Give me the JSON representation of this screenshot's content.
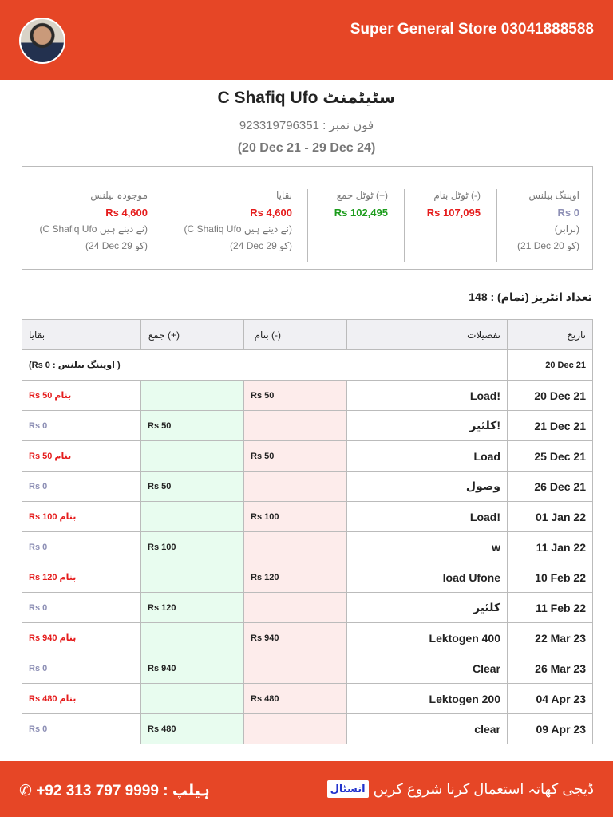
{
  "header": {
    "store": "Super General Store 03041888588"
  },
  "statement": {
    "title": "C Shafiq Ufo سٹیٹمنٹ",
    "phone": "فون نمبر : 923319796351",
    "range": "(20 Dec 21 - 29 Dec 24)"
  },
  "summary": {
    "opening": {
      "label": "اوپننگ بیلنس",
      "value": "Rs 0",
      "note": "(برابر)",
      "date": "(21 Dec کو 20)"
    },
    "banam": {
      "label": "ٹوٹل بنام (-)",
      "value": "Rs 107,095"
    },
    "jama": {
      "label": "ٹوٹل جمع (+)",
      "value": "Rs 102,495"
    },
    "baqaya": {
      "label": "بقایا",
      "value": "Rs 4,600",
      "note": "(C Shafiq Ufo نے دینے ہیں)",
      "date": "(24 Dec کو 29)"
    },
    "current": {
      "label": "موجودہ بیلنس",
      "value": "Rs 4,600",
      "note": "(C Shafiq Ufo نے دینے ہیں)",
      "date": "(24 Dec کو 29)"
    }
  },
  "entries_count": "تعداد انٹریز (تمام) : 148",
  "table": {
    "headers": {
      "date": "تاریخ",
      "details": "تفصیلات",
      "banam": "بنام (-)",
      "jama": "جمع (+)",
      "baqaya": "بقایا"
    },
    "opening_row": {
      "date": "20 Dec 21",
      "text": "(Rs 0 : اوپننگ بیلنس )"
    },
    "rows": [
      {
        "date": "20 Dec 21",
        "details": "Load!",
        "banam": "Rs 50",
        "jama": "",
        "baqaya": "Rs 50 بنام"
      },
      {
        "date": "21 Dec 21",
        "details": "کلئیر!",
        "banam": "",
        "jama": "Rs 50",
        "baqaya": "Rs 0"
      },
      {
        "date": "25 Dec 21",
        "details": "Load",
        "banam": "Rs 50",
        "jama": "",
        "baqaya": "Rs 50 بنام"
      },
      {
        "date": "26 Dec 21",
        "details": "وصول",
        "banam": "",
        "jama": "Rs 50",
        "baqaya": "Rs 0"
      },
      {
        "date": "01 Jan 22",
        "details": "Load!",
        "banam": "Rs 100",
        "jama": "",
        "baqaya": "Rs 100 بنام"
      },
      {
        "date": "11 Jan 22",
        "details": "w",
        "banam": "",
        "jama": "Rs 100",
        "baqaya": "Rs 0"
      },
      {
        "date": "10 Feb 22",
        "details": "load Ufone",
        "banam": "Rs 120",
        "jama": "",
        "baqaya": "Rs 120 بنام"
      },
      {
        "date": "11 Feb 22",
        "details": "کلئیر",
        "banam": "",
        "jama": "Rs 120",
        "baqaya": "Rs 0"
      },
      {
        "date": "22 Mar 23",
        "details": "Lektogen 400",
        "banam": "Rs 940",
        "jama": "",
        "baqaya": "Rs 940 بنام"
      },
      {
        "date": "26 Mar 23",
        "details": "Clear",
        "banam": "",
        "jama": "Rs 940",
        "baqaya": "Rs 0"
      },
      {
        "date": "04 Apr 23",
        "details": "Lektogen 200",
        "banam": "Rs 480",
        "jama": "",
        "baqaya": "Rs 480 بنام"
      },
      {
        "date": "09 Apr 23",
        "details": "clear",
        "banam": "",
        "jama": "Rs 480",
        "baqaya": "Rs 0"
      }
    ]
  },
  "footer": {
    "help": "+92 313 797 9999 : ہیلپ",
    "promo": "ڈیجی کھاتہ استعمال کرنا شروع کریں",
    "install": "انسٹال"
  }
}
